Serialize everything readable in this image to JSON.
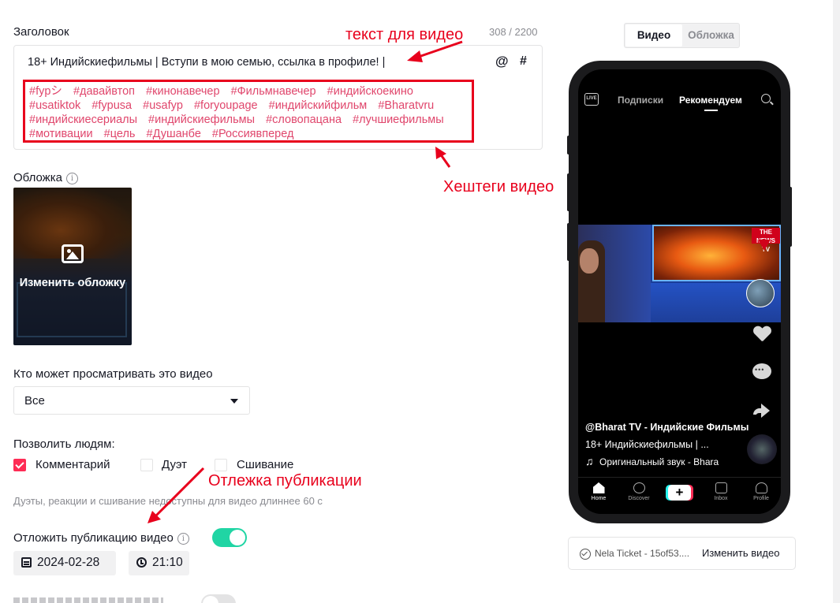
{
  "form": {
    "title_label": "Заголовок",
    "char_counter": "308 / 2200",
    "caption_text": "18+ Индийскиефильмы | Вступи в мою семью, ссылка в профиле! |",
    "mention_symbol": "@",
    "hashtag_symbol": "#",
    "hashtags": [
      "#fypシ",
      "#давайвтоп",
      "#кинонавечер",
      "#Фильмнавечер",
      "#индийскоекино",
      "#usatiktok",
      "#fypusa",
      "#usafyp",
      "#foryoupage",
      "#индийскийфильм",
      "#Bharatvru",
      "#индийскиесериалы",
      "#индийскиефильмы",
      "#словопацана",
      "#лучшиефильмы",
      "#мотивации",
      "#цель",
      "#Душанбе",
      "#Россиявперед"
    ],
    "cover_label": "Обложка",
    "info_symbol": "i",
    "change_cover_label": "Изменить обложку",
    "privacy_label": "Кто может просматривать это видео",
    "privacy_value": "Все",
    "allow_label": "Позволить людям:",
    "allow_options": [
      {
        "label": "Комментарий",
        "checked": true
      },
      {
        "label": "Дуэт",
        "checked": false
      },
      {
        "label": "Сшивание",
        "checked": false
      }
    ],
    "duet_note": "Дуэты, реакции и сшивание недоступны для видео длиннее 60 с",
    "schedule_label": "Отложить публикацию видео",
    "schedule_enabled": true,
    "schedule_date": "2024-02-28",
    "schedule_time": "21:10"
  },
  "annotations": {
    "video_text": "текст для видео",
    "video_hashtags": "Хештеги видео",
    "delay_publication": "Отлежка публикации",
    "color": "#e8001c"
  },
  "preview": {
    "tab_video": "Видео",
    "tab_cover": "Обложка",
    "active_tab": "Видео",
    "top_nav": {
      "live": "LIVE",
      "following": "Подписки",
      "for_you": "Рекомендуем"
    },
    "user_line": "@Bharat TV - Индийские Фильмы",
    "caption_line": "18+ Индийскиефильмы | ...",
    "sound_line": "Оригинальный звук - Bhara",
    "news_badge": "THE NEWS TV",
    "bottom_tabs": [
      "Home",
      "Discover",
      "+",
      "Inbox",
      "Profile"
    ],
    "file_name": "Nela Ticket - 15of53....",
    "change_video_label": "Изменить видео"
  },
  "colors": {
    "accent": "#fe2c55",
    "hashtag": "#e0466c",
    "toggle_on": "#20d5a4"
  }
}
